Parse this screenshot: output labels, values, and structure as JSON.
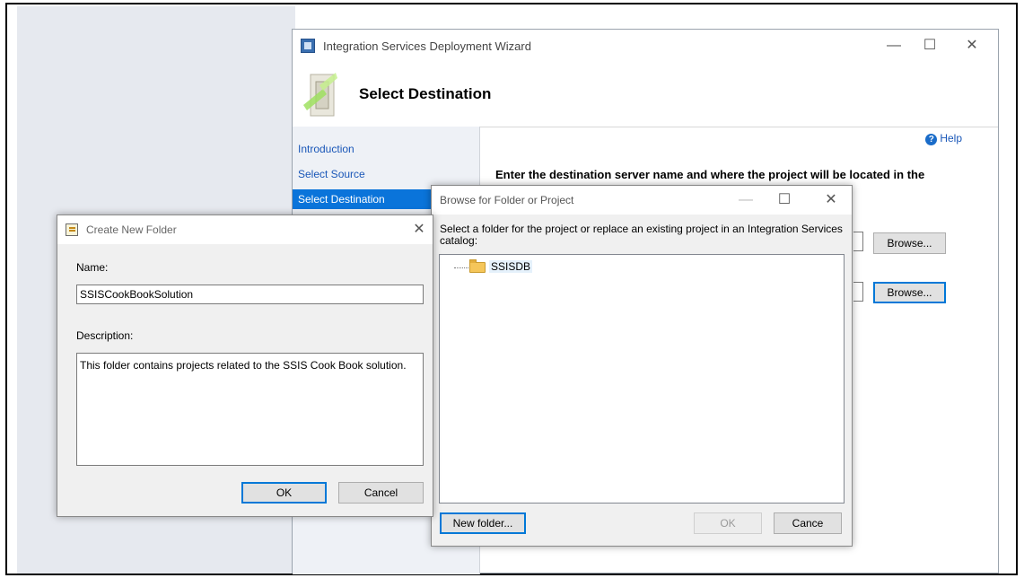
{
  "wizard": {
    "title": "Integration Services Deployment Wizard",
    "header_title": "Select Destination",
    "nav": [
      "Introduction",
      "Select Source",
      "Select Destination"
    ],
    "help_label": "Help",
    "instruction": "Enter the destination server name and where the project will be located in the",
    "browse_label": "Browse..."
  },
  "browse_dialog": {
    "title": "Browse for Folder or Project",
    "description": "Select a folder for the project or replace an existing project in an Integration Services catalog:",
    "tree_item": "SSISDB",
    "new_folder_label": "New folder...",
    "ok_label": "OK",
    "cancel_label": "Cance"
  },
  "create_folder": {
    "title": "Create New Folder",
    "name_label": "Name:",
    "name_value": "SSISCookBookSolution",
    "description_label": "Description:",
    "description_value": "This folder contains projects related to the SSIS Cook Book solution.",
    "ok_label": "OK",
    "cancel_label": "Cancel"
  },
  "icons": {
    "minimize": "—",
    "maximize": "☐",
    "close": "✕",
    "help_glyph": "?"
  }
}
